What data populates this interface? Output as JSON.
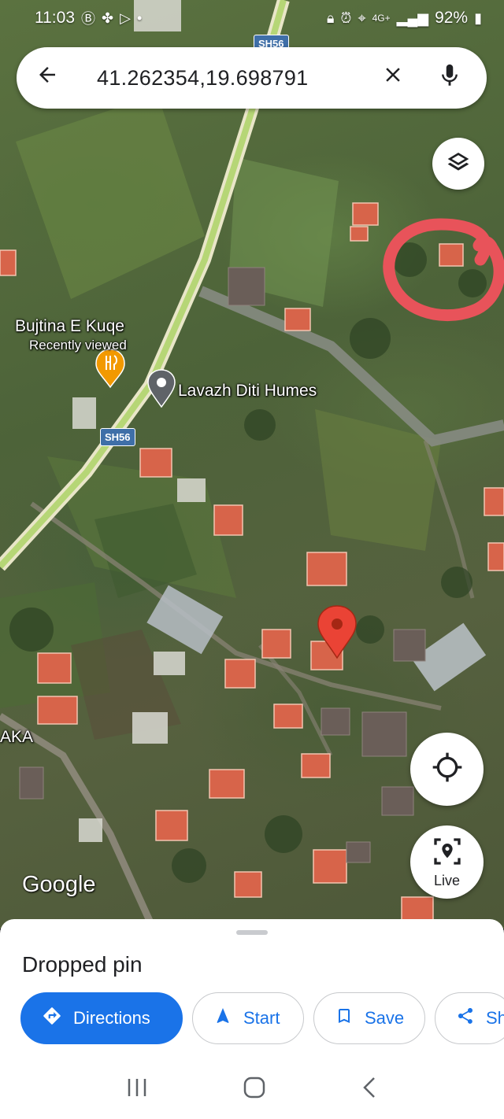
{
  "status_bar": {
    "time": "11:03",
    "left_icons": [
      "b-icon",
      "pinwheel-icon",
      "play-store-icon",
      "dot-icon"
    ],
    "right_icons": [
      "lock-icon",
      "alarm-icon",
      "location-icon",
      "4g-icon",
      "signal-icon"
    ],
    "network": "4G+",
    "battery": "92%"
  },
  "search": {
    "query": "41.262354,19.698791"
  },
  "map": {
    "route_shields": [
      "SH56",
      "SH56"
    ],
    "places": [
      {
        "name": "Bujtina E Kuqe",
        "note": "Recently viewed",
        "icon": "restaurant-icon",
        "color": "#f29900"
      },
      {
        "name": "Lavazh Diti Humes",
        "icon": "place-pin-icon",
        "color": "#5f6368"
      }
    ],
    "edge_label": "AKA",
    "attribution": "Google",
    "dropped_pin_color": "#ea4335",
    "annotation_circle_color": "#e8535a"
  },
  "controls": {
    "layers": "layers-icon",
    "locate": "my-location-icon",
    "live_label": "Live"
  },
  "sheet": {
    "title": "Dropped pin",
    "actions": [
      {
        "label": "Directions",
        "icon": "directions-icon"
      },
      {
        "label": "Start",
        "icon": "navigation-arrow-icon"
      },
      {
        "label": "Save",
        "icon": "bookmark-icon"
      },
      {
        "label": "Sh",
        "icon": "share-icon"
      }
    ]
  },
  "colors": {
    "accent": "#1a73e8",
    "road": "#c9d77a"
  }
}
